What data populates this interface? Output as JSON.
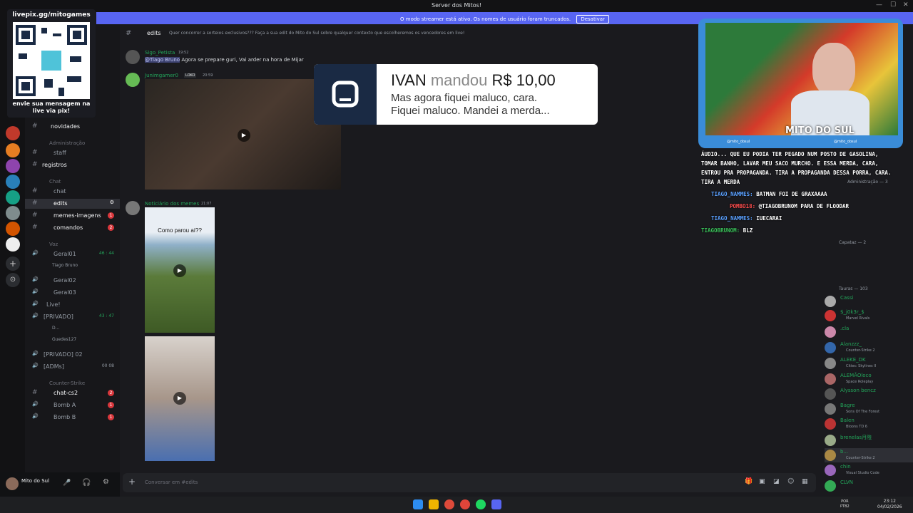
{
  "window": {
    "title": "Server dos Mitos!"
  },
  "banner": {
    "text": "O modo streamer está ativo. Os nomes de usuário foram truncados.",
    "button": "Desativar"
  },
  "overlay": {
    "qr_title": "livepix.gg/mitogames",
    "qr_caption": "envie sua mensagem na live via pix!"
  },
  "channels": [
    {
      "label": "novidades",
      "type": "text",
      "bold": true
    },
    {
      "label": "Administração",
      "type": "category"
    },
    {
      "label": "staff",
      "type": "text"
    },
    {
      "label": "registros",
      "type": "text",
      "bold": true
    },
    {
      "label": "Chat",
      "type": "category"
    },
    {
      "label": "chat",
      "type": "text"
    },
    {
      "label": "edits",
      "type": "text",
      "selected": true
    },
    {
      "label": "memes-imagens",
      "type": "text",
      "bold": true,
      "badge": "1"
    },
    {
      "label": "comandos",
      "type": "text",
      "bold": true,
      "badge": "2"
    },
    {
      "label": "Voz",
      "type": "category"
    },
    {
      "label": "Geral01",
      "type": "voice",
      "extra": "46 : 44"
    },
    {
      "label": "Tiago Bruno",
      "type": "voiceuser"
    },
    {
      "label": "Geral02",
      "type": "voice"
    },
    {
      "label": "Geral03",
      "type": "voice"
    },
    {
      "label": "Live!",
      "type": "voice"
    },
    {
      "label": "[PRIVADO]",
      "type": "voice",
      "extra": "43 : 47"
    },
    {
      "label": "D...",
      "type": "voiceuser"
    },
    {
      "label": "Guedes127",
      "type": "voiceuser"
    },
    {
      "label": "[PRIVADO] 02",
      "type": "voice"
    },
    {
      "label": "[ADMs]",
      "type": "voice",
      "extra": "00  08"
    },
    {
      "label": "Counter-Strike",
      "type": "category"
    },
    {
      "label": "chat-cs2",
      "type": "text",
      "bold": true,
      "badge": "2"
    },
    {
      "label": "Bomb A",
      "type": "voice",
      "badge": "1"
    },
    {
      "label": "Bomb B",
      "type": "voice",
      "badge": "1"
    }
  ],
  "user": {
    "name": "Mito do Sul"
  },
  "chat_header": {
    "channel": "edits",
    "topic": "Quer concorrer a sorteios exclusivos??? Faça a sua edit do Mito do Sul sobre qualquer contexto que escolheremos os vencedores em live!"
  },
  "messages": [
    {
      "author": "Sigo_Petista",
      "time": "19:52",
      "mention": "@Tiago Bruno",
      "text": "Agora se prepare guri, Vai arder na hora de Mijar",
      "color": "#23a55a"
    },
    {
      "author": "Junimgamer0",
      "time": "20:59",
      "tag": "LOKO",
      "color": "#23a55a"
    },
    {
      "author": "Noticiário dos memes",
      "time": "21:07",
      "color": "#23a55a",
      "video_caption": "Como parou aí??"
    }
  ],
  "donation": {
    "name": "IVAN",
    "verb": "mandou",
    "amount": "R$ 10,00",
    "message_1": "Mas agora fiquei maluco, cara.",
    "message_2": "Fiquei maluco. Mandei a merda..."
  },
  "stream": {
    "socials_1": "@mito_dosul",
    "socials_2": "@mito_dosul",
    "tag": "MITO DO SUL"
  },
  "captions": [
    {
      "text": "ÁUDIO... QUE EU PODIA TER PEGADO NUM POSTO DE GASOLINA, TOMAR BANHO, LAVAR MEU SACO MURCHO. E ESSA MERDA, CARA, ENTROU PRA PROPAGANDA. TIRA A PROPAGANDA DESSA PORRA, CARA. TIRA A MERDA"
    },
    {
      "user": "TIAGO_NAMMES:",
      "text": "BATMAN FOI DE GRAXAAAA"
    },
    {
      "user": "POMBO18:",
      "text": "@TIAGOBRUNOM PARA DE FLOODAR"
    },
    {
      "user": "TIAGO_NAMMES:",
      "text": "IUECARAI"
    },
    {
      "user": "TIAGOBRUNOM:",
      "text": "BLZ"
    }
  ],
  "members_categories": [
    {
      "label": "Administração — 3"
    },
    {
      "label": "Capataz — 2"
    },
    {
      "label": "Tauras — 103"
    }
  ],
  "members": [
    {
      "name": "Cassi",
      "status": ""
    },
    {
      "name": "$_j0k3r_$",
      "status": "Marvel Rivals",
      "tag": "BIST"
    },
    {
      "name": ".cla",
      "status": ""
    },
    {
      "name": "Alanzzz_",
      "status": "Counter-Strike 2",
      "tag": "GOAT"
    },
    {
      "name": "ALEKE_DK",
      "status": "Cities: Skylines II"
    },
    {
      "name": "ALEMÃOloco",
      "status": "Space Roleplay"
    },
    {
      "name": "Alysson bencz",
      "status": ""
    },
    {
      "name": "Bagre",
      "status": "Sons Of The Forest"
    },
    {
      "name": "Balen",
      "status": "Bloons TD 6"
    },
    {
      "name": "brenelas月陰",
      "status": ""
    },
    {
      "name": "b...",
      "status": "Counter-Strike 2",
      "tag": "GTA"
    },
    {
      "name": "chin",
      "status": "Visual Studio Code"
    },
    {
      "name": "CLVN",
      "status": ""
    }
  ],
  "composer": {
    "placeholder": "Conversar em #edits"
  },
  "taskbar": {
    "lang": "POR",
    "layout": "PTB2",
    "time": "23:12",
    "date": "04/02/2026"
  }
}
